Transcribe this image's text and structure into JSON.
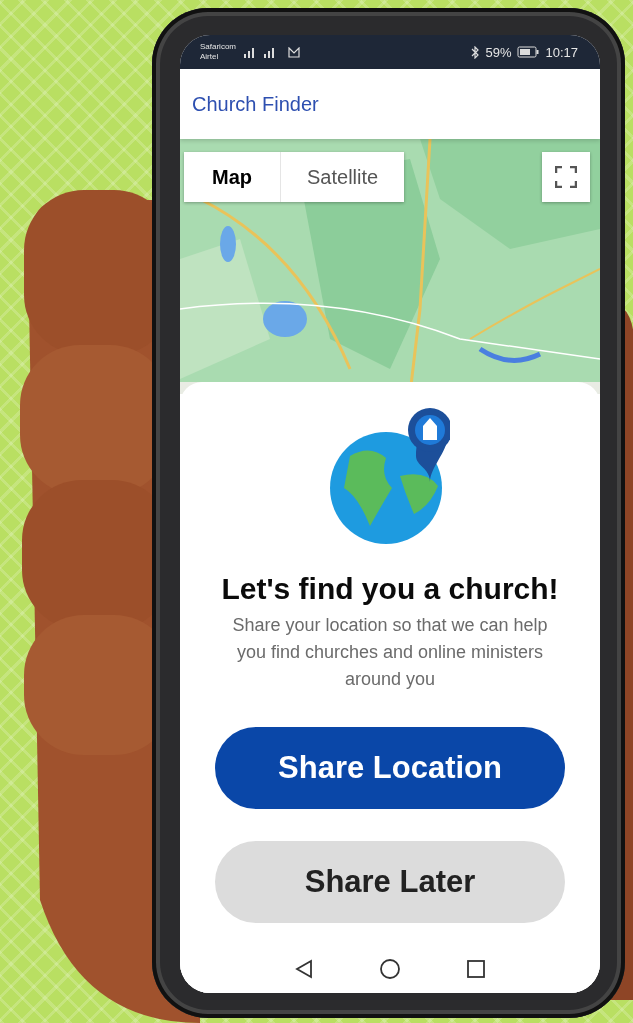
{
  "status_bar": {
    "carriers": [
      "Safaricom",
      "Airtel"
    ],
    "battery": "59%",
    "time": "10:17"
  },
  "app_bar": {
    "title": "Church Finder"
  },
  "map": {
    "kind": "picture",
    "type_tabs": [
      {
        "label": "Map",
        "selected": true
      },
      {
        "label": "Satellite",
        "selected": false
      }
    ]
  },
  "prompt": {
    "title": "Let's find you a church!",
    "message": "Share your location so that we can help you find churches and online ministers around you",
    "buttons": [
      {
        "label": "Share Location",
        "kind": "primary"
      },
      {
        "label": "Share Later",
        "kind": "secondary"
      }
    ]
  }
}
